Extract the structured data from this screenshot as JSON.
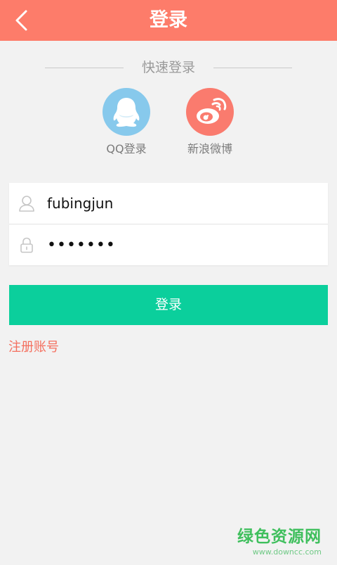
{
  "header": {
    "title": "登录",
    "background_color": "#fd7c6a"
  },
  "quick_login": {
    "title": "快速登录",
    "options": [
      {
        "label": "QQ登录",
        "icon": "qq-penguin-icon",
        "color": "#87c9ec"
      },
      {
        "label": "新浪微博",
        "icon": "weibo-icon",
        "color": "#fa7b6e"
      }
    ]
  },
  "form": {
    "username": {
      "value": "fubingjun",
      "icon": "user-icon"
    },
    "password": {
      "value": "•••••••",
      "icon": "lock-icon"
    }
  },
  "login_button": {
    "label": "登录",
    "color": "#0bcf9c"
  },
  "register_link": {
    "label": "注册账号",
    "color": "#f46f5e"
  },
  "watermark": {
    "name": "绿色资源网",
    "url": "www.downcc.com"
  }
}
